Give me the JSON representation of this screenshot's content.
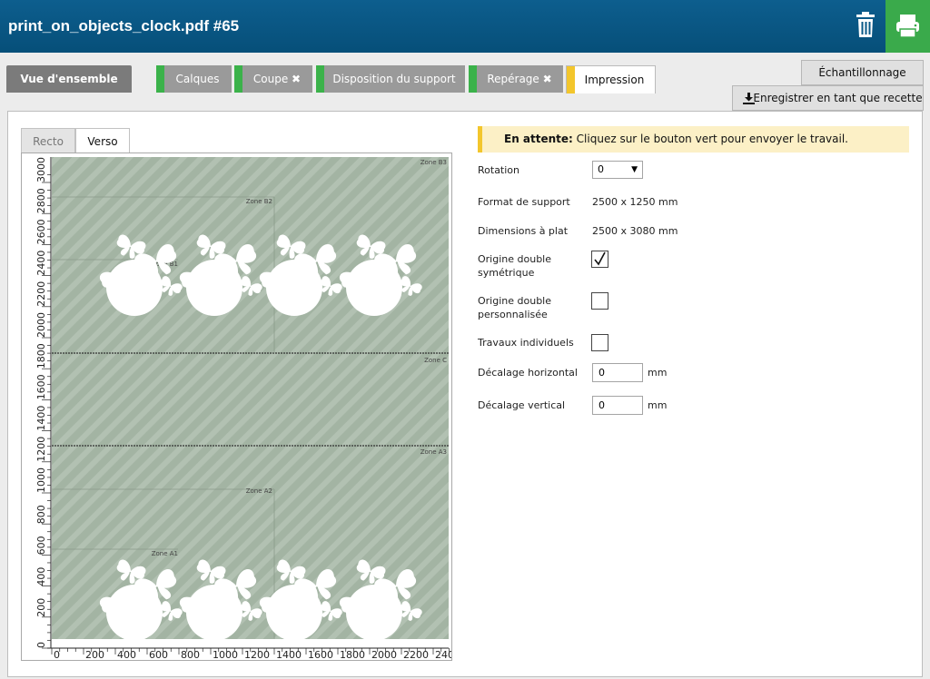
{
  "header": {
    "title": "print_on_objects_clock.pdf #65"
  },
  "tabs": [
    {
      "label": "Vue d'ensemble"
    },
    {
      "label": "Calques"
    },
    {
      "label": "Coupe ✖"
    },
    {
      "label": "Disposition du support"
    },
    {
      "label": "Repérage ✖"
    },
    {
      "label": "Impression"
    }
  ],
  "right_buttons": {
    "sampling": "Échantillonnage",
    "save_recipe": "Enregistrer en tant que recette"
  },
  "side_tabs": {
    "recto": "Recto",
    "verso": "Verso"
  },
  "preview": {
    "zones": [
      "Zone B3",
      "Zone B2",
      "Zone B1",
      "Zone C",
      "Zone A3",
      "Zone A2",
      "Zone A1"
    ],
    "y_ticks": [
      "0",
      "200",
      "400",
      "600",
      "800",
      "1000",
      "1200",
      "1400",
      "1600",
      "1800",
      "2000",
      "2200",
      "2400",
      "2600",
      "2800",
      "3000"
    ],
    "x_ticks": [
      "0",
      "200",
      "400",
      "600",
      "800",
      "1000",
      "1200",
      "1400",
      "1600",
      "1800",
      "2000",
      "2200",
      "2400"
    ]
  },
  "notice": {
    "status": "En attente:",
    "message": "Cliquez sur le bouton vert pour envoyer le travail."
  },
  "form": {
    "rotation_label": "Rotation",
    "rotation_value": "0",
    "media_format_label": "Format de support",
    "media_format_value": "2500 x 1250 mm",
    "flat_dim_label": "Dimensions à plat",
    "flat_dim_value": "2500 x 3080 mm",
    "double_sym_label_1": "Origine double",
    "double_sym_label_2": "symétrique",
    "double_custom_label_1": "Origine double",
    "double_custom_label_2": "personnalisée",
    "individual_label": "Travaux individuels",
    "h_offset_label": "Décalage horizontal",
    "h_offset_value": "0",
    "v_offset_label": "Décalage vertical",
    "v_offset_value": "0",
    "unit": "mm"
  },
  "checkboxes": {
    "double_symmetric": true,
    "double_custom": false,
    "individual_jobs": false
  },
  "colors": {
    "header": "#0a5987",
    "print_button": "#3aaa4b",
    "tab_done": "#3bb24a",
    "tab_pending": "#f3c62c",
    "media": "#a3b4a3"
  }
}
